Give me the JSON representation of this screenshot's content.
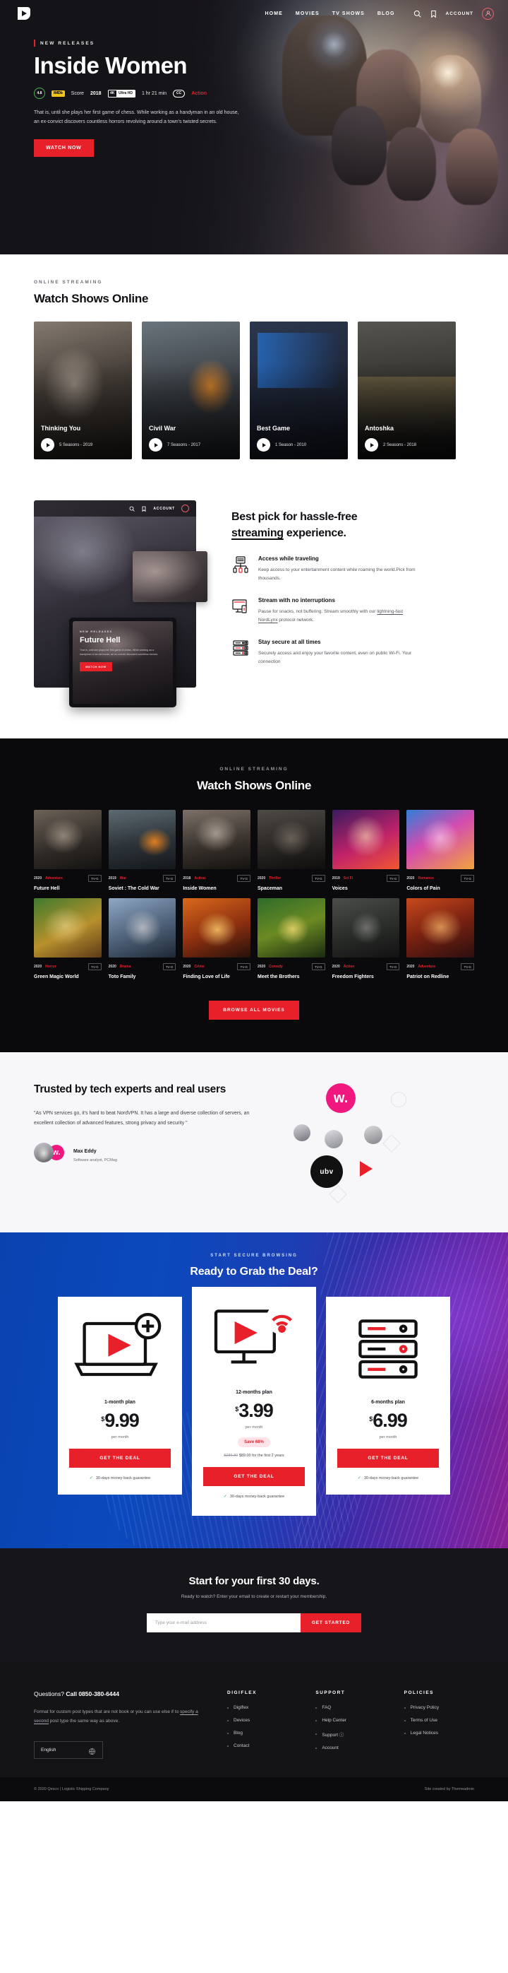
{
  "header": {
    "logo_icon": "play-logo-icon",
    "nav": [
      {
        "label": "HOME"
      },
      {
        "label": "MOVIES"
      },
      {
        "label": "TV SHOWS"
      },
      {
        "label": "BLOG"
      }
    ],
    "search_icon": "search-icon",
    "bookmark_icon": "bookmark-icon",
    "account_label": "ACCOUNT",
    "avatar_icon": "user-avatar-icon"
  },
  "hero": {
    "eyebrow": "NEW RELEASES",
    "title": "Inside Women",
    "score": "4.8",
    "imdb": "IMDb",
    "score_label": "Score",
    "year": "2018",
    "quality_4k": "4K",
    "quality_hd": "Ultra HD",
    "duration": "1 hr 21 min",
    "cc": "CC",
    "genre": "Action",
    "description": "That is, until she plays her first game of chess. While working as a handyman in an old house, an ex-convict discovers countless horrors revolving around a town's twisted secrets.",
    "cta": "WATCH NOW"
  },
  "shows": {
    "kicker": "ONLINE STREAMING",
    "title": "Watch Shows Online",
    "cards": [
      {
        "title": "Thinking You",
        "sub": "5 Seasons - 2019",
        "play_icon": "play-icon"
      },
      {
        "title": "Civil War",
        "sub": "7 Seasons - 2017",
        "play_icon": "play-icon"
      },
      {
        "title": "Best Game",
        "sub": "1 Season - 2010",
        "play_icon": "play-icon"
      },
      {
        "title": "Antoshka",
        "sub": "2 Seasons - 2018",
        "play_icon": "play-icon"
      }
    ]
  },
  "device_preview": {
    "account_label": "ACCOUNT",
    "search_icon": "search-icon",
    "bookmark_icon": "bookmark-icon",
    "phone_eyebrow": "NEW RELEASES",
    "phone_title": "Future Hell",
    "phone_desc": "That is, until she plays her first game of chess. While working as a handyman in an old house, an ex-convict discovers countless horrors.",
    "phone_cta": "WATCH NOW"
  },
  "bestpick": {
    "title_line1": "Best pick for hassle-free",
    "title_underline": "streaming",
    "title_line2": " experience.",
    "features": [
      {
        "icon": "network-servers-icon",
        "heading": "Access while traveling",
        "body": "Keep access to your entertainment content while roaming the world.Pick from thousands."
      },
      {
        "icon": "desktop-monitor-icon",
        "heading": "Stream with no interruptions",
        "body_pre": "Pause for snacks, not buffering. Stream smoothly with our ",
        "body_link": "lightning-fast NordLynx",
        "body_post": " protocol network."
      },
      {
        "icon": "server-rack-icon",
        "heading": "Stay secure at all times",
        "body": "Securely access and enjoy your favorite content, even on public Wi-Fi. Your connection"
      }
    ]
  },
  "movies": {
    "kicker": "ONLINE STREAMING",
    "title": "Watch Shows Online",
    "browse_label": "BROWSE ALL MOVIES",
    "items": [
      {
        "year": "2020",
        "genre": "Adventure",
        "rating": "TV-G",
        "title": "Future Hell"
      },
      {
        "year": "2019",
        "genre": "War",
        "rating": "TV-G",
        "title": "Soviet : The Cold War"
      },
      {
        "year": "2018",
        "genre": "Action",
        "rating": "TV-G",
        "title": "Inside Women"
      },
      {
        "year": "2020",
        "genre": "Thriller",
        "rating": "TV-G",
        "title": "Spaceman"
      },
      {
        "year": "2019",
        "genre": "Sci Fi",
        "rating": "TV-G",
        "title": "Voices"
      },
      {
        "year": "2020",
        "genre": "Romance",
        "rating": "TV-G",
        "title": "Colors of Pain"
      },
      {
        "year": "2020",
        "genre": "Horror",
        "rating": "TV-G",
        "title": "Green Magic World"
      },
      {
        "year": "2020",
        "genre": "Drama",
        "rating": "TV-G",
        "title": "Toto Family"
      },
      {
        "year": "2020",
        "genre": "Crime",
        "rating": "TV-G",
        "title": "Finding Love of Life"
      },
      {
        "year": "2020",
        "genre": "Comedy",
        "rating": "TV-G",
        "title": "Meet the Brothers"
      },
      {
        "year": "2020",
        "genre": "Action",
        "rating": "TV-G",
        "title": "Freedom Fighters"
      },
      {
        "year": "2020",
        "genre": "Adventure",
        "rating": "TV-G",
        "title": "Patriot on Redline"
      }
    ]
  },
  "trusted": {
    "heading": "Trusted by tech experts and real users",
    "quote": "\"As VPN services go, it's hard to beat NordVPN. It has a large and diverse collection of servers, an excellent collection of advanced features, strong privacy and security \"",
    "person_name": "Max Eddy",
    "person_role": "Software analyst, PCMag",
    "logo_w": "w.",
    "logo_ubv": "ubv"
  },
  "pricing": {
    "kicker": "START SECURE BROWSING",
    "title": "Ready to Grab the Deal?",
    "plans": [
      {
        "icon": "laptop-plus-icon",
        "name": "1-month plan",
        "currency": "$",
        "amount": "9.99",
        "per": "per month",
        "save": "",
        "strike_old": "",
        "strike_new": "",
        "cta": "GET THE DEAL",
        "guarantee": "30-days money-back guarantee"
      },
      {
        "icon": "monitor-wifi-icon",
        "name": "12-months plan",
        "currency": "$",
        "amount": "3.99",
        "per": "per month",
        "save": "Save 68%",
        "strike_old": "$286.80",
        "strike_new": "$89.00 for the first 2 years",
        "cta": "GET THE DEAL",
        "guarantee": "30-days money-back guarantee"
      },
      {
        "icon": "server-stack-icon",
        "name": "6-months plan",
        "currency": "$",
        "amount": "6.99",
        "per": "per month",
        "save": "",
        "strike_old": "",
        "strike_new": "",
        "cta": "GET THE DEAL",
        "guarantee": "30-days money-back guarantee"
      }
    ]
  },
  "signup": {
    "heading": "Start for your first 30 days.",
    "sub": "Ready to watch? Enter your email to create or restart your membership.",
    "placeholder": "Type your e-mail address",
    "cta": "GET STARTED"
  },
  "footer": {
    "questions_prefix": "Questions? ",
    "questions_bold": "Call 0850-380-6444",
    "text_pre": "Format for custom post types that are not book or you can use else if to ",
    "text_link": "specify a second",
    "text_post": " post type the same way as above.",
    "language": "English",
    "globe_icon": "globe-icon",
    "columns": [
      {
        "heading": "DIGIFLEX",
        "links": [
          {
            "label": "Digiflex"
          },
          {
            "label": "Devices"
          },
          {
            "label": "Blog"
          },
          {
            "label": "Contact"
          }
        ]
      },
      {
        "heading": "SUPPORT",
        "links": [
          {
            "label": "FAQ"
          },
          {
            "label": "Help Center"
          },
          {
            "label": "Support ⓘ"
          },
          {
            "label": "Account"
          }
        ]
      },
      {
        "heading": "POLICIES",
        "links": [
          {
            "label": "Privacy Policy"
          },
          {
            "label": "Terms of Use"
          },
          {
            "label": "Legal Notices"
          }
        ]
      }
    ],
    "copyright": "© 2020 Qesco | Logistic Shipping Company",
    "credit": "Site created by Themeadmin"
  }
}
